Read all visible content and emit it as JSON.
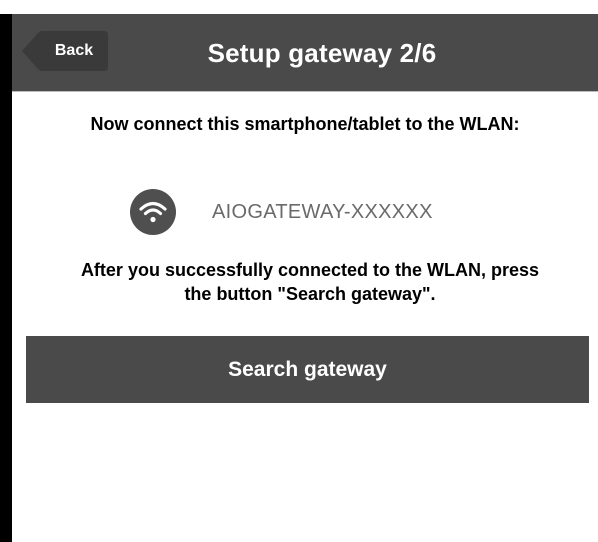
{
  "header": {
    "back_label": "Back",
    "title": "Setup gateway 2/6"
  },
  "main": {
    "instruction": "Now connect this smartphone/tablet to the WLAN:",
    "network": {
      "icon": "wifi-icon",
      "name": "AIOGATEWAY-XXXXXX"
    },
    "after_text_line1": "After you successfully connected to the WLAN, press",
    "after_text_line2": "the button \"Search gateway\".",
    "search_button_label": "Search gateway"
  },
  "colors": {
    "header_bg": "#4a4a4a",
    "button_bg": "#4a4a4a",
    "wifi_circle": "#4f4f4f",
    "network_text": "#6a6a6a"
  }
}
